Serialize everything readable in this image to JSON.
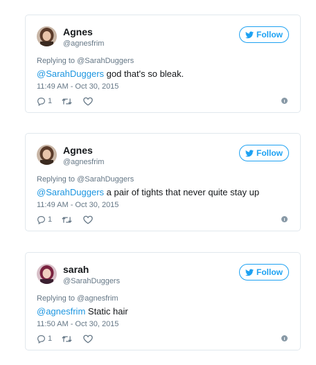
{
  "colors": {
    "accent": "#1da1f2",
    "mention": "#1b95e0",
    "muted": "#657786",
    "border": "#e1e8ed"
  },
  "tweets": [
    {
      "name": "Agnes",
      "handle": "@agnesfrim",
      "follow_label": "Follow",
      "replying_prefix": "Replying to ",
      "replying_handle": "@SarahDuggers",
      "mention": "@SarahDuggers",
      "text": " god that's so bleak.",
      "timestamp": "11:49 AM - Oct 30, 2015",
      "reply_count": "1",
      "icons": [
        "reply-icon",
        "retweet-icon",
        "like-icon",
        "info-icon"
      ]
    },
    {
      "name": "Agnes",
      "handle": "@agnesfrim",
      "follow_label": "Follow",
      "replying_prefix": "Replying to ",
      "replying_handle": "@SarahDuggers",
      "mention": "@SarahDuggers",
      "text": " a pair of tights that never quite stay up",
      "timestamp": "11:49 AM - Oct 30, 2015",
      "reply_count": "1",
      "icons": [
        "reply-icon",
        "retweet-icon",
        "like-icon",
        "info-icon"
      ]
    },
    {
      "name": "sarah",
      "handle": "@SarahDuggers",
      "follow_label": "Follow",
      "replying_prefix": "Replying to ",
      "replying_handle": "@agnesfrim",
      "mention": "@agnesfrim",
      "text": " Static hair",
      "timestamp": "11:50 AM - Oct 30, 2015",
      "reply_count": "1",
      "icons": [
        "reply-icon",
        "retweet-icon",
        "like-icon",
        "info-icon"
      ]
    }
  ]
}
